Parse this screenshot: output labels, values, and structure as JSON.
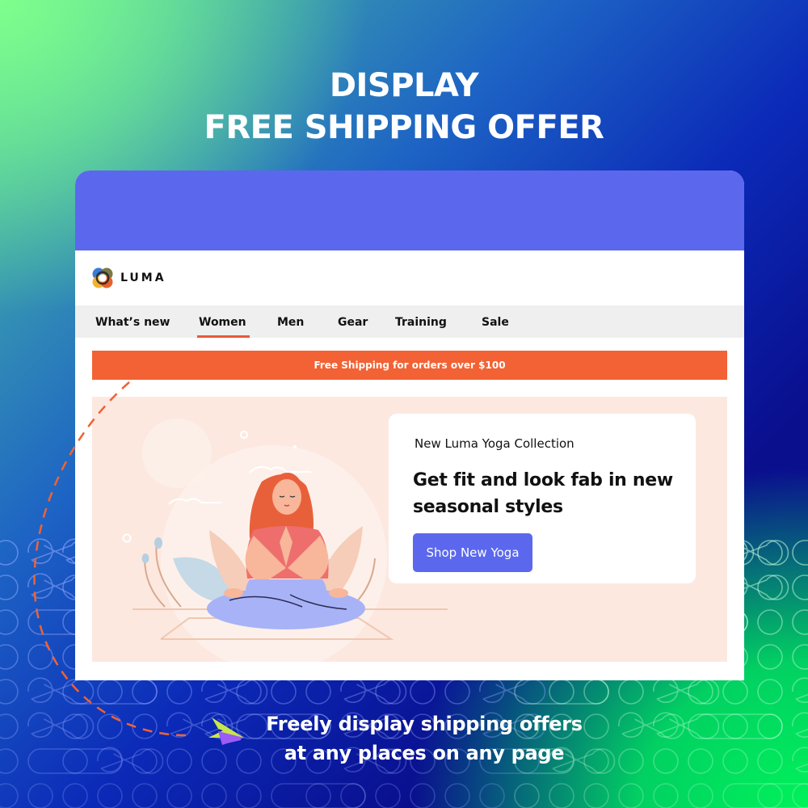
{
  "headline": {
    "line1": "DISPLAY",
    "line2": "FREE SHIPPING OFFER"
  },
  "store": {
    "logo_text": "LUMA",
    "nav": [
      {
        "label": "What’s new",
        "active": false
      },
      {
        "label": "Women",
        "active": true
      },
      {
        "label": "Men",
        "active": false
      },
      {
        "label": "Gear",
        "active": false
      },
      {
        "label": "Training",
        "active": false
      },
      {
        "label": "Sale",
        "active": false
      }
    ],
    "promo_bar": {
      "text": "Free Shipping for orders over $100"
    },
    "hero": {
      "eyebrow": "New Luma Yoga Collection",
      "title": "Get fit and look fab in new seasonal styles",
      "button_label": "Shop New Yoga"
    }
  },
  "caption": {
    "line1": "Freely display shipping offers",
    "line2": "at any places on any page"
  },
  "colors": {
    "browser_header": "#5b68ee",
    "promo_bar": "#f26234",
    "active_underline": "#e8583a",
    "hero_background": "#fde8e0",
    "button": "#5b68ee",
    "dashed_arrow": "#f26234"
  }
}
